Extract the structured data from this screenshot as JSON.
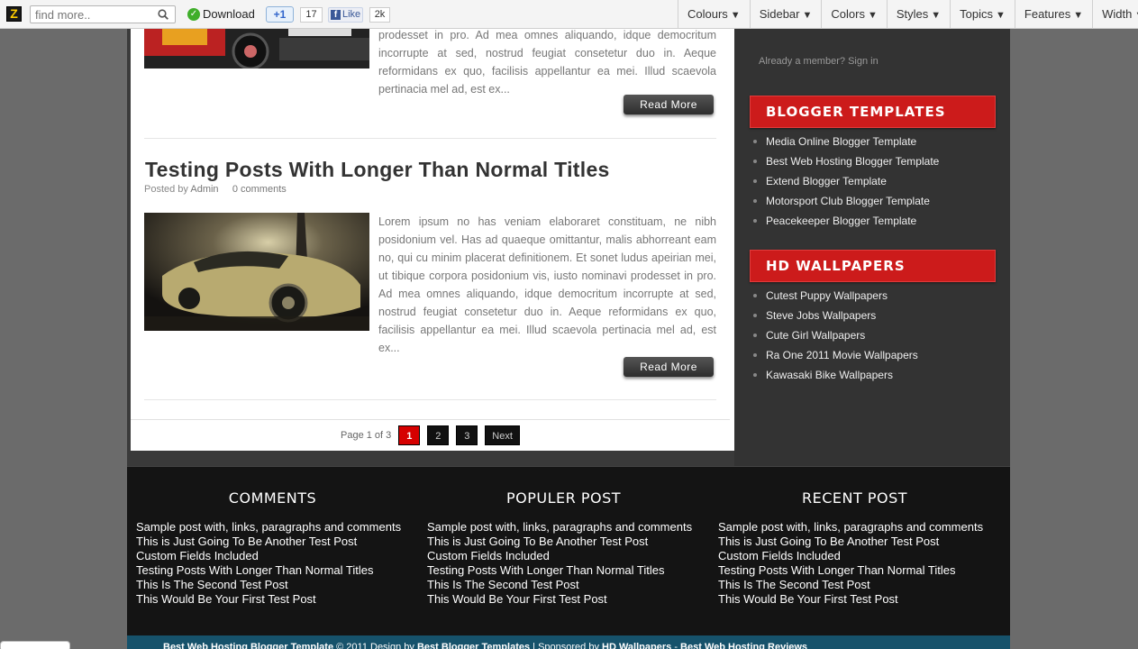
{
  "toolbar": {
    "logo": "Z",
    "search_placeholder": "find more..",
    "download_label": "Download",
    "gplus_label": "+1",
    "gplus_count": "17",
    "fb_label": "Like",
    "fb_count": "2k",
    "menus": [
      {
        "label": "Colours"
      },
      {
        "label": "Sidebar"
      },
      {
        "label": "Colors"
      },
      {
        "label": "Styles"
      },
      {
        "label": "Topics"
      },
      {
        "label": "Features"
      },
      {
        "label": "Width"
      }
    ],
    "arrow": "▼"
  },
  "posts": [
    {
      "excerpt": "prodesset in pro. Ad mea omnes aliquando, idque democritum incorrupte at sed, nostrud feugiat consetetur duo in. Aeque reformidans ex quo, facilisis appellantur ea mei. Illud scaevola pertinacia mel ad, est ex...",
      "read_more": "Read More"
    },
    {
      "title": "Testing Posts With Longer Than Normal Titles",
      "meta_prefix": "Posted by",
      "author": "Admin",
      "comments": "0 comments",
      "excerpt": "Lorem ipsum no has veniam elaboraret constituam, ne nibh posidonium vel. Has ad quaeque omittantur, malis abhorreant eam no, qui cu minim placerat definitionem. Et sonet ludus apeirian mei, ut tibique corpora posidonium vis, iusto nominavi prodesset in pro. Ad mea omnes aliquando, idque democritum incorrupte at sed, nostrud feugiat consetetur duo in. Aeque reformidans ex quo, facilisis appellantur ea mei. Illud scaevola pertinacia mel ad, est ex...",
      "read_more": "Read More"
    }
  ],
  "pagination": {
    "label": "Page 1 of 3",
    "pages": [
      "1",
      "2",
      "3"
    ],
    "next": "Next"
  },
  "sidebar": {
    "member_text": "Already a member?",
    "signin": "Sign in",
    "widgets": [
      {
        "title": "BLOGGER TEMPLATES",
        "items": [
          "Media Online Blogger Template",
          "Best Web Hosting Blogger Template",
          "Extend Blogger Template",
          "Motorsport Club Blogger Template",
          "Peacekeeper Blogger Template"
        ]
      },
      {
        "title": "HD WALLPAPERS",
        "items": [
          "Cutest Puppy Wallpapers",
          "Steve Jobs Wallpapers",
          "Cute Girl Wallpapers",
          "Ra One 2011 Movie Wallpapers",
          "Kawasaki Bike Wallpapers"
        ]
      }
    ]
  },
  "footer": {
    "columns": [
      {
        "title": "COMMENTS",
        "items": [
          "Sample post with, links, paragraphs and comments",
          "This is Just Going To Be Another Test Post",
          "Custom Fields Included",
          "Testing Posts With Longer Than Normal Titles",
          "This Is The Second Test Post",
          "This Would Be Your First Test Post"
        ]
      },
      {
        "title": "POPULER POST",
        "items": [
          "Sample post with, links, paragraphs and comments",
          "This is Just Going To Be Another Test Post",
          "Custom Fields Included",
          "Testing Posts With Longer Than Normal Titles",
          "This Is The Second Test Post",
          "This Would Be Your First Test Post"
        ]
      },
      {
        "title": "RECENT POST",
        "items": [
          "Sample post with, links, paragraphs and comments",
          "This is Just Going To Be Another Test Post",
          "Custom Fields Included",
          "Testing Posts With Longer Than Normal Titles",
          "This Is The Second Test Post",
          "This Would Be Your First Test Post"
        ]
      }
    ],
    "copyright": {
      "site": "Best Web Hosting Blogger Template",
      "middle": "© 2011 Design by",
      "designer": "Best Blogger Templates",
      "sponsored": "| Sponsored by",
      "sponsor1": "HD Wallpapers",
      "sep": "-",
      "sponsor2": "Best Web Hosting Reviews"
    }
  },
  "colors": {
    "accent_red": "#cc1b1b",
    "footer_bg": "#141414",
    "copy_bar": "#16526b"
  }
}
